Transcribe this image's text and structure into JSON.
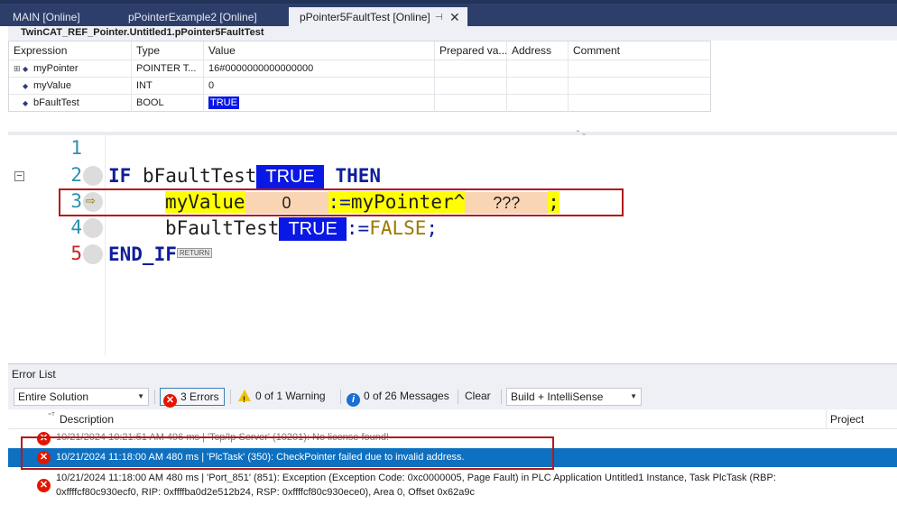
{
  "tabs": [
    {
      "label": "MAIN [Online]"
    },
    {
      "label": "pPointerExample2 [Online]"
    },
    {
      "label": "pPointer5FaultTest [Online]",
      "pin": "⊣",
      "close": "✕"
    }
  ],
  "watch": {
    "title": "TwinCAT_REF_Pointer.Untitled1.pPointer5FaultTest",
    "headers": {
      "expression": "Expression",
      "type": "Type",
      "value": "Value",
      "prepared": "Prepared va...",
      "address": "Address",
      "comment": "Comment"
    },
    "rows": [
      {
        "expression": "myPointer",
        "type": "POINTER T...",
        "value": "16#0000000000000000",
        "expandable": true
      },
      {
        "expression": "myValue",
        "type": "INT",
        "value": "0",
        "expandable": false
      },
      {
        "expression": "bFaultTest",
        "type": "BOOL",
        "value": "TRUE",
        "expandable": false
      }
    ]
  },
  "editor": {
    "line_numbers": [
      "1",
      "2",
      "3",
      "4",
      "5"
    ],
    "line2": {
      "kw_if": "IF",
      "var": "bFaultTest",
      "monitor": "TRUE",
      "kw_then": "THEN"
    },
    "line3": {
      "var": "myValue",
      "monitor": "0",
      "op": ":=",
      "ptr": "myPointer^",
      "monitor2": "???",
      "end": ";"
    },
    "line4": {
      "var": "bFaultTest",
      "monitor": "TRUE",
      "op": ":=",
      "lit": "FALSE",
      "end": ";"
    },
    "line5": {
      "kw": "END_IF",
      "tag": "RETURN"
    }
  },
  "error_list": {
    "title": "Error List",
    "scope": "Entire Solution",
    "errors_btn": "3 Errors",
    "warnings_btn": "0 of 1 Warning",
    "messages_btn": "0 of 26 Messages",
    "clear_btn": "Clear",
    "build_filter": "Build + IntelliSense",
    "col_description": "Description",
    "col_project": "Project",
    "rows": [
      {
        "text": "10/21/2024 10:21:51 AM 496 ms | 'Tcp/Ip Server' (10201): No license found!"
      },
      {
        "text": "10/21/2024 11:18:00 AM 480 ms | 'PlcTask' (350): CheckPointer failed due to invalid address."
      },
      {
        "text": "10/21/2024 11:18:00 AM 480 ms | 'Port_851' (851): Exception (Exception Code: 0xc0000005, Page Fault) in PLC Application Untitled1 Instance, Task PlcTask (RBP: 0xffffcf80c930ecf0, RIP: 0xffffba0d2e512b24, RSP: 0xffffcf80c930ece0), Area 0, Offset 0x62a9c"
      }
    ]
  },
  "colors": {
    "monitor_true": "#0a18e6",
    "current_line": "#ffff00",
    "selection": "#0e70c0",
    "annotation_box": "#b21a1a"
  }
}
